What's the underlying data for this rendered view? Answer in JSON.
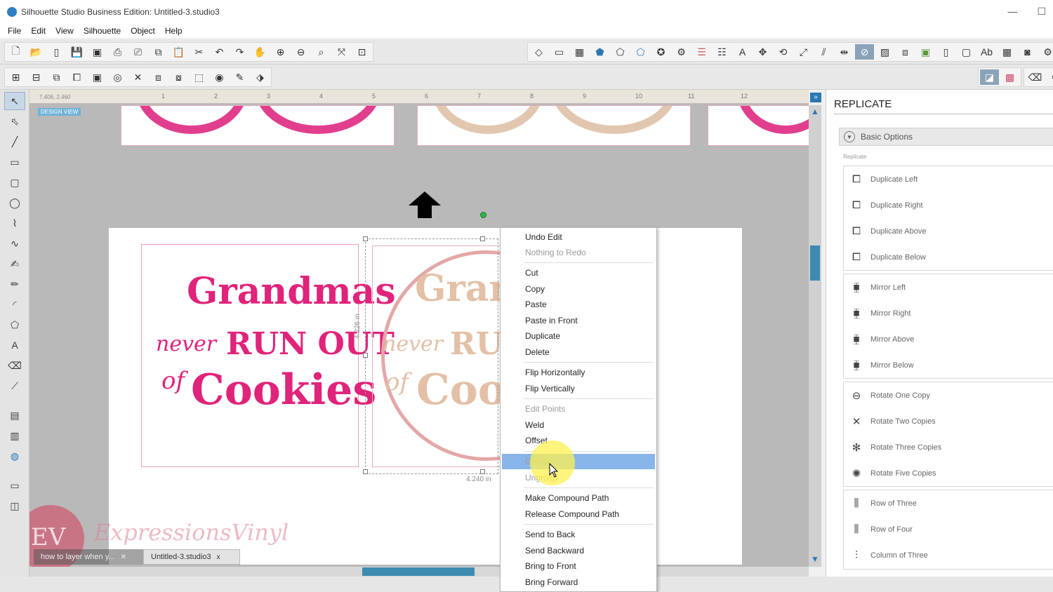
{
  "window": {
    "title": "Silhouette Studio Business Edition: Untitled-3.studio3",
    "minimize": "—",
    "maximize": "☐"
  },
  "menus": [
    "File",
    "Edit",
    "View",
    "Silhouette",
    "Object",
    "Help"
  ],
  "ruler": {
    "coords": "7.406, 2.460",
    "numbers": [
      "1",
      "2",
      "3",
      "4",
      "5",
      "6",
      "7",
      "8",
      "9",
      "10",
      "11",
      "12"
    ],
    "design_view": "DESIGN VIEW"
  },
  "canvas": {
    "design_text": {
      "line1": "Grandmas",
      "line2a": "never",
      "line2b": "RUN OUT",
      "line3a": "of",
      "line3b": "Cookies"
    },
    "ghost_text": {
      "line1": "Grandm",
      "line2a": "never",
      "line2b": "RUN",
      "line3a": "of",
      "line3b": "Cook"
    },
    "height_label": "4.226 in",
    "width_label": "4.240 in"
  },
  "watermark": {
    "initials": "EV",
    "text": "ExpressionsVinyl"
  },
  "tabs": [
    {
      "label": "how to layer when y...",
      "close": "✕"
    },
    {
      "label": "Untitled-3.studio3",
      "close": "x"
    }
  ],
  "context_menu": [
    {
      "label": "Undo Edit",
      "enabled": true
    },
    {
      "label": "Nothing to Redo",
      "enabled": false
    },
    {
      "label": "Cut",
      "enabled": true
    },
    {
      "label": "Copy",
      "enabled": true
    },
    {
      "label": "Paste",
      "enabled": true
    },
    {
      "label": "Paste in Front",
      "enabled": true
    },
    {
      "label": "Duplicate",
      "enabled": true
    },
    {
      "label": "Delete",
      "enabled": true
    },
    {
      "label": "Flip Horizontally",
      "enabled": true
    },
    {
      "label": "Flip Vertically",
      "enabled": true
    },
    {
      "label": "Edit Points",
      "enabled": false
    },
    {
      "label": "Weld",
      "enabled": true
    },
    {
      "label": "Offset",
      "enabled": true
    },
    {
      "label": "Group",
      "enabled": false,
      "highlighted": true
    },
    {
      "label": "Ungroup",
      "enabled": false
    },
    {
      "label": "Make Compound Path",
      "enabled": true
    },
    {
      "label": "Release Compound Path",
      "enabled": true
    },
    {
      "label": "Send to Back",
      "enabled": true
    },
    {
      "label": "Send Backward",
      "enabled": true
    },
    {
      "label": "Bring to Front",
      "enabled": true
    },
    {
      "label": "Bring Forward",
      "enabled": true
    }
  ],
  "panel": {
    "title": "REPLICATE",
    "section": "Basic Options",
    "sub": "Replicate",
    "groups": [
      [
        "Duplicate Left",
        "Duplicate Right",
        "Duplicate Above",
        "Duplicate Below"
      ],
      [
        "Mirror Left",
        "Mirror Right",
        "Mirror Above",
        "Mirror Below"
      ],
      [
        "Rotate One Copy",
        "Rotate Two Copies",
        "Rotate Three Copies",
        "Rotate Five Copies"
      ],
      [
        "Row of Three",
        "Row of Four",
        "Column of Three"
      ]
    ]
  },
  "colors": {
    "accent": "#2b79b3",
    "design_pink": "#e0237b",
    "beige": "#e3c0a6",
    "menu_highlight": "#88b6ea"
  }
}
